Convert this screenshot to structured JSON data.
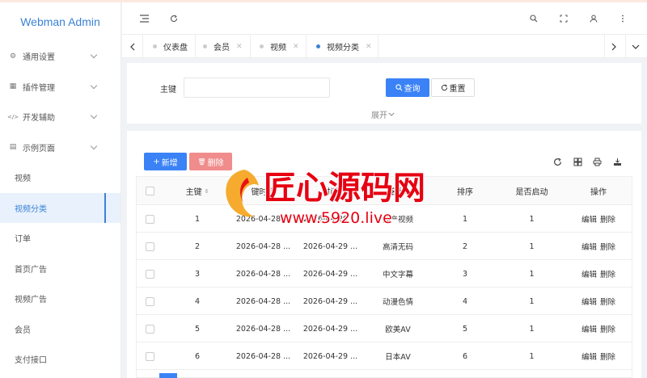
{
  "app": {
    "title": "Webman Admin"
  },
  "sidebar": {
    "items": [
      {
        "label": "通用设置",
        "icon": "gear-icon"
      },
      {
        "label": "插件管理",
        "icon": "plugin-icon"
      },
      {
        "label": "开发辅助",
        "icon": "code-icon"
      },
      {
        "label": "示例页面",
        "icon": "page-icon"
      }
    ],
    "subitems": [
      {
        "label": "视频"
      },
      {
        "label": "视频分类"
      },
      {
        "label": "订单"
      },
      {
        "label": "首页广告"
      },
      {
        "label": "视频广告"
      },
      {
        "label": "会员"
      },
      {
        "label": "支付接口"
      }
    ]
  },
  "tabs": [
    {
      "label": "仪表盘"
    },
    {
      "label": "会员"
    },
    {
      "label": "视频"
    },
    {
      "label": "视频分类"
    }
  ],
  "search": {
    "key_label": "主键",
    "query_label": "查询",
    "reset_label": "重置",
    "expand_label": "展开"
  },
  "toolbar": {
    "add_label": "新增",
    "delete_label": "删除"
  },
  "table": {
    "headers": [
      "主键",
      "键时间",
      "时间",
      "名称",
      "排序",
      "是否启动",
      "操作"
    ],
    "rows": [
      {
        "id": "1",
        "created": "2026-04-28 ...",
        "updated": "2026-04-29 ...",
        "name": "国产视频",
        "sort": "1",
        "enabled": "1"
      },
      {
        "id": "2",
        "created": "2026-04-28 ...",
        "updated": "2026-04-29 ...",
        "name": "高清无码",
        "sort": "2",
        "enabled": "1"
      },
      {
        "id": "3",
        "created": "2026-04-28 ...",
        "updated": "2026-04-29 ...",
        "name": "中文字幕",
        "sort": "3",
        "enabled": "1"
      },
      {
        "id": "4",
        "created": "2026-04-28 ...",
        "updated": "2026-04-29 ...",
        "name": "动漫色情",
        "sort": "4",
        "enabled": "1"
      },
      {
        "id": "5",
        "created": "2026-04-28 ...",
        "updated": "2026-04-29 ...",
        "name": "欧美AV",
        "sort": "5",
        "enabled": "1"
      },
      {
        "id": "6",
        "created": "2026-04-28 ...",
        "updated": "2026-04-29 ...",
        "name": "日本AV",
        "sort": "6",
        "enabled": "1"
      }
    ],
    "edit_label": "编辑",
    "del_label": "删除"
  },
  "watermark": {
    "title": "匠心源码网",
    "url": "www.5920.live"
  },
  "colors": {
    "accent": "#3b82f6",
    "danger": "#f08c8c",
    "brand": "#3b82d6",
    "watermark": "#e60012"
  }
}
